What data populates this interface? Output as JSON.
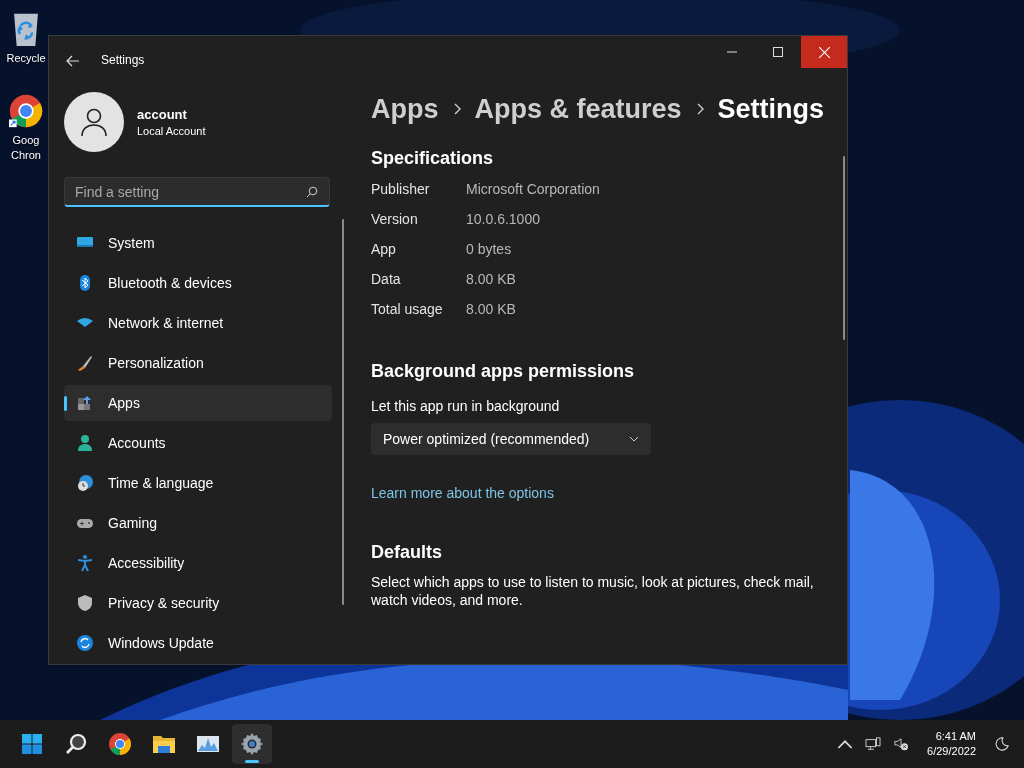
{
  "desktop_icons": [
    {
      "kind": "recycle",
      "label_lines": [
        "Recycle"
      ]
    },
    {
      "kind": "chrome",
      "label_lines": [
        "Goog",
        "Chron"
      ]
    }
  ],
  "window": {
    "title": "Settings"
  },
  "account": {
    "name": "account",
    "type": "Local Account"
  },
  "search": {
    "placeholder": "Find a setting"
  },
  "nav_items": [
    {
      "label": "System",
      "selected": false
    },
    {
      "label": "Bluetooth & devices",
      "selected": false
    },
    {
      "label": "Network & internet",
      "selected": false
    },
    {
      "label": "Personalization",
      "selected": false
    },
    {
      "label": "Apps",
      "selected": true
    },
    {
      "label": "Accounts",
      "selected": false
    },
    {
      "label": "Time & language",
      "selected": false
    },
    {
      "label": "Gaming",
      "selected": false
    },
    {
      "label": "Accessibility",
      "selected": false
    },
    {
      "label": "Privacy & security",
      "selected": false
    },
    {
      "label": "Windows Update",
      "selected": false
    }
  ],
  "breadcrumb": [
    "Apps",
    "Apps & features",
    "Settings"
  ],
  "specifications": {
    "heading": "Specifications",
    "rows": [
      {
        "label": "Publisher",
        "value": "Microsoft Corporation"
      },
      {
        "label": "Version",
        "value": "10.0.6.1000"
      },
      {
        "label": "App",
        "value": "0 bytes"
      },
      {
        "label": "Data",
        "value": "8.00 KB"
      },
      {
        "label": "Total usage",
        "value": "8.00 KB"
      }
    ]
  },
  "background_permissions": {
    "heading": "Background apps permissions",
    "label": "Let this app run in background",
    "dropdown": {
      "value": "Power optimized (recommended)"
    },
    "link": "Learn more about the options"
  },
  "defaults": {
    "heading": "Defaults",
    "description": "Select which apps to use to listen to music, look at pictures, check mail, watch videos, and more."
  },
  "taskbar": {
    "apps": [
      {
        "kind": "start",
        "selected": false
      },
      {
        "kind": "search",
        "selected": false
      },
      {
        "kind": "chrome",
        "selected": false
      },
      {
        "kind": "folder",
        "selected": false
      },
      {
        "kind": "monitor",
        "selected": false
      },
      {
        "kind": "settings",
        "selected": true
      }
    ],
    "time": "6:41 AM",
    "date": "6/29/2022"
  }
}
